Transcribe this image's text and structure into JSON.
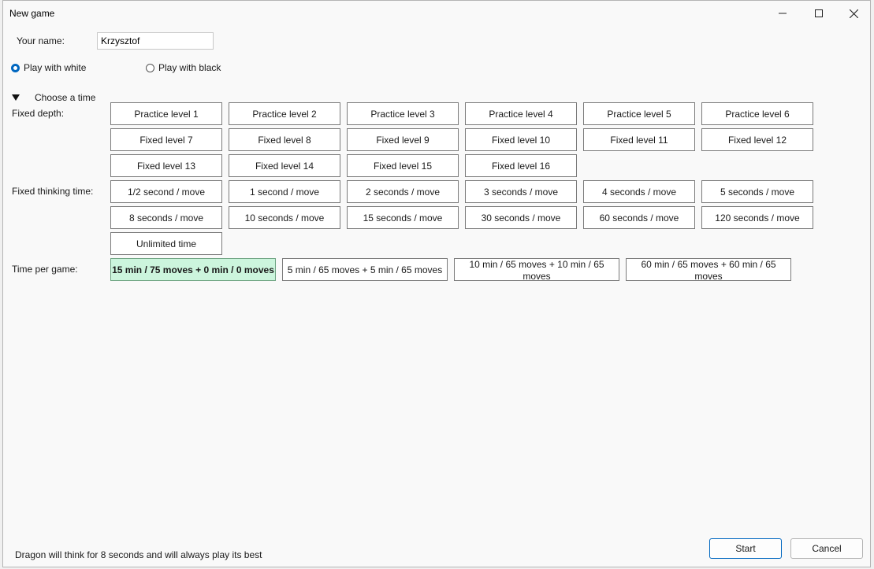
{
  "window": {
    "title": "New game",
    "minimize_glyph": "—",
    "maximize_glyph": "☐",
    "close_glyph": "✕"
  },
  "form": {
    "name_label": "Your name:",
    "name_value": "Krzysztof",
    "play_white_label": "Play with white",
    "play_black_label": "Play with black",
    "selected_color": "white",
    "choose_time_label": "Choose a time"
  },
  "groups": {
    "fixed_depth_label": "Fixed depth:",
    "fixed_depth": [
      "Practice level 1",
      "Practice level 2",
      "Practice level 3",
      "Practice level 4",
      "Practice level 5",
      "Practice level 6",
      "Fixed level 7",
      "Fixed level 8",
      "Fixed level 9",
      "Fixed level 10",
      "Fixed level 11",
      "Fixed level 12",
      "Fixed level 13",
      "Fixed level 14",
      "Fixed level 15",
      "Fixed level 16"
    ],
    "fixed_thinking_label": "Fixed thinking time:",
    "fixed_thinking": [
      "1/2 second / move",
      "1 second / move",
      "2 seconds / move",
      "3 seconds / move",
      "4 seconds / move",
      "5 seconds / move",
      "8 seconds / move",
      "10 seconds / move",
      "15 seconds / move",
      "30 seconds / move",
      "60 seconds / move",
      "120 seconds / move",
      "Unlimited time"
    ],
    "time_per_game_label": "Time per game:",
    "time_per_game": [
      "15 min / 75 moves + 0 min / 0 moves",
      "5 min / 65 moves + 5 min / 65 moves",
      "10 min / 65 moves + 10 min / 65 moves",
      "60 min / 65 moves + 60 min / 65 moves"
    ],
    "selected_time_per_game": 0
  },
  "footer": {
    "status": "Dragon will think for 8 seconds and will always play its best",
    "start_label": "Start",
    "cancel_label": "Cancel"
  },
  "colors": {
    "accent": "#0067c0",
    "selected_bg": "#ccf5dd"
  }
}
